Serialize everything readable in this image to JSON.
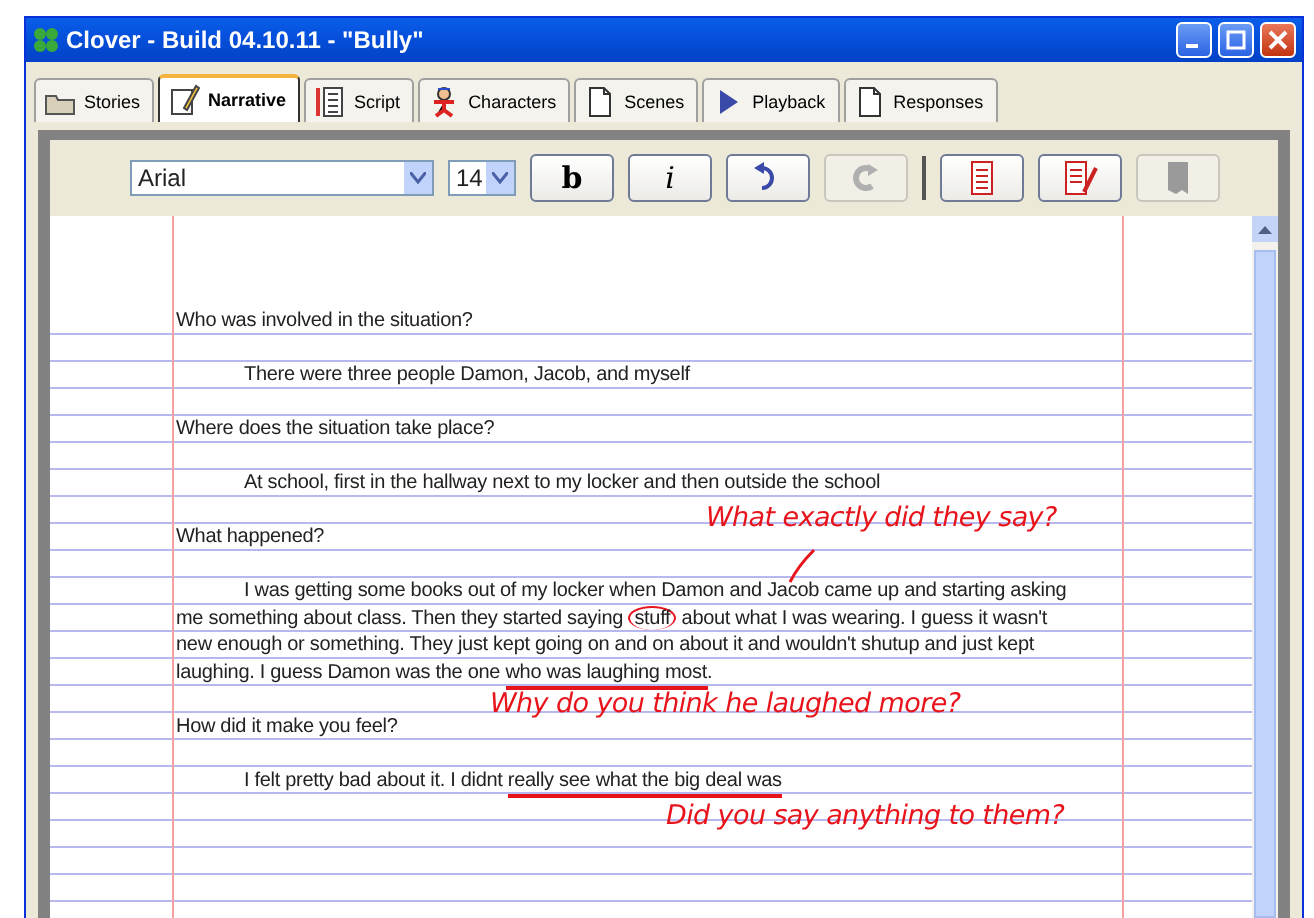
{
  "window": {
    "title": "Clover - Build 04.10.11 - \"Bully\""
  },
  "tabs": [
    {
      "label": "Stories",
      "selected": false
    },
    {
      "label": "Narrative",
      "selected": true
    },
    {
      "label": "Script",
      "selected": false
    },
    {
      "label": "Characters",
      "selected": false
    },
    {
      "label": "Scenes",
      "selected": false
    },
    {
      "label": "Playback",
      "selected": false
    },
    {
      "label": "Responses",
      "selected": false
    }
  ],
  "toolbar": {
    "font": "Arial",
    "size": "14",
    "buttons": [
      {
        "kind": "bold",
        "label": "b",
        "disabled": false
      },
      {
        "kind": "italic",
        "label": "i",
        "disabled": false
      },
      {
        "kind": "undo",
        "disabled": false
      },
      {
        "kind": "redo",
        "disabled": true
      },
      {
        "kind": "separator"
      },
      {
        "kind": "doc",
        "disabled": false
      },
      {
        "kind": "docpen",
        "disabled": false
      },
      {
        "kind": "blank",
        "disabled": true
      }
    ]
  },
  "document": [
    {
      "kind": "question",
      "segments": [
        {
          "text": "Who was involved in the situation?",
          "circled": false,
          "underlined": false
        }
      ]
    },
    {
      "kind": "answer",
      "segments": [
        {
          "text": "There were three people Damon, Jacob, and myself",
          "circled": false,
          "underlined": false
        }
      ]
    },
    {
      "kind": "question",
      "segments": [
        {
          "text": "Where does the situation take place?",
          "circled": false,
          "underlined": false
        }
      ]
    },
    {
      "kind": "answer",
      "segments": [
        {
          "text": "At school, first in the hallway next to my locker and then outside the school",
          "circled": false,
          "underlined": false
        }
      ]
    },
    {
      "kind": "question",
      "segments": [
        {
          "text": "What happened?",
          "circled": false,
          "underlined": false
        }
      ]
    },
    {
      "kind": "answer",
      "segments": [
        {
          "text": "I was getting some books out of my locker when Damon and Jacob came up and starting asking me something about class. Then they started saying ",
          "circled": false,
          "underlined": false
        },
        {
          "text": "stuff",
          "circled": true,
          "underlined": false
        },
        {
          "text": " about what I was wearing. I guess it wasn't new enough or something. They just kept going on and on about it and wouldn't shutup and just kept laughing. I guess Damon was the one ",
          "circled": false,
          "underlined": false
        },
        {
          "text": "who was laughing most",
          "circled": false,
          "underlined": true
        },
        {
          "text": ".",
          "circled": false,
          "underlined": false
        }
      ]
    },
    {
      "kind": "question",
      "segments": [
        {
          "text": "How did it make you feel?",
          "circled": false,
          "underlined": false
        }
      ]
    },
    {
      "kind": "answer",
      "segments": [
        {
          "text": "I felt pretty bad about it. I didnt ",
          "circled": false,
          "underlined": false
        },
        {
          "text": "really see what the big deal was",
          "circled": false,
          "underlined": true
        }
      ]
    }
  ],
  "annotations": [
    {
      "text": "What exactly did they say?"
    },
    {
      "text": "Why do you think he laughed more?"
    },
    {
      "text": "Did you say anything to them?"
    }
  ]
}
